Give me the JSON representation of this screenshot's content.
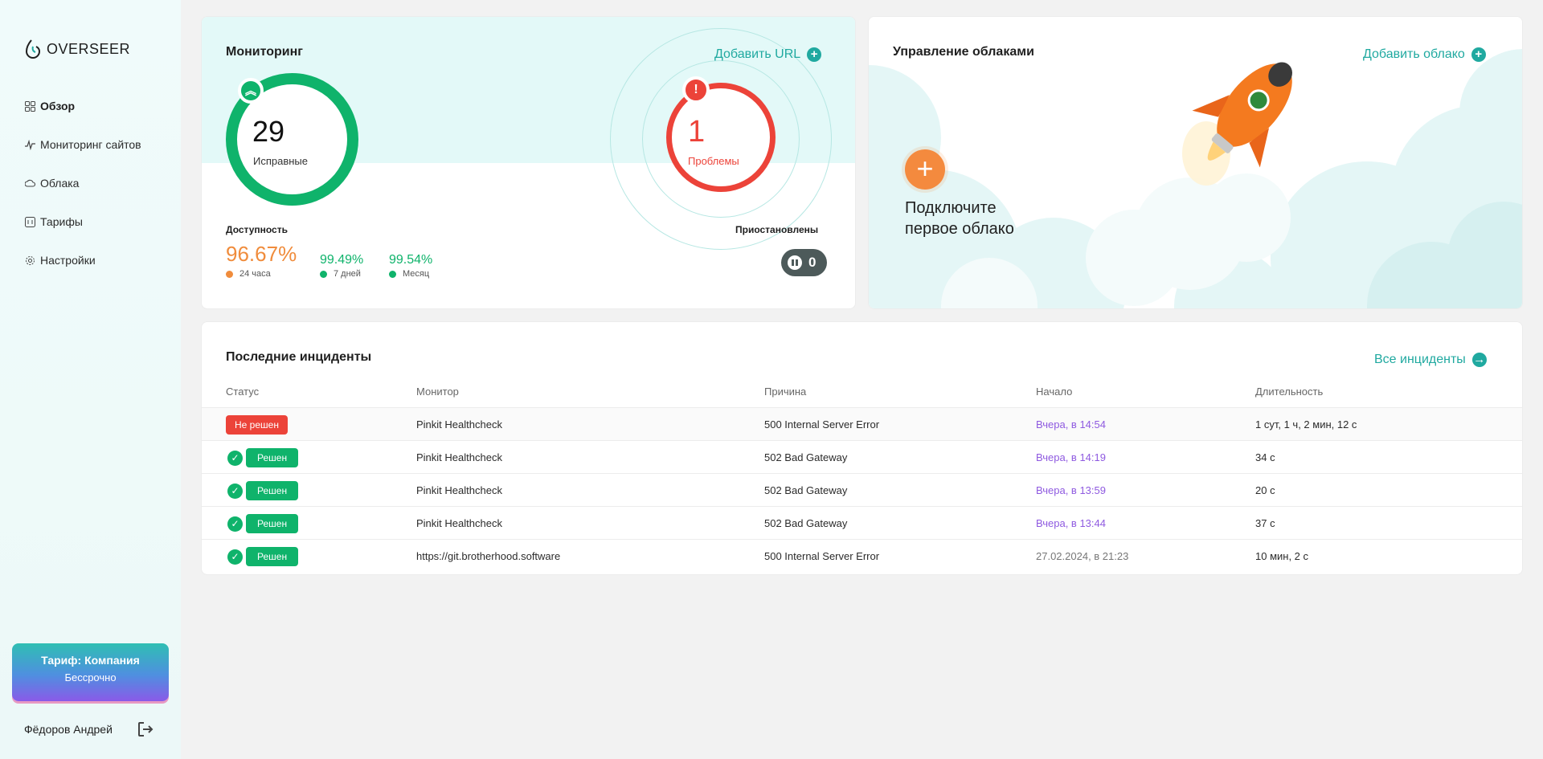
{
  "app": {
    "logo_text": "OVERSEER"
  },
  "sidebar": {
    "items": [
      {
        "label": "Обзор",
        "icon": "grid-icon"
      },
      {
        "label": "Мониторинг сайтов",
        "icon": "pulse-icon"
      },
      {
        "label": "Облака",
        "icon": "cloud-icon"
      },
      {
        "label": "Тарифы",
        "icon": "tariff-icon"
      },
      {
        "label": "Настройки",
        "icon": "gear-icon"
      }
    ],
    "plan": {
      "title": "Тариф: Компания",
      "subtitle": "Бессрочно"
    },
    "user": {
      "name": "Фёдоров Андрей"
    }
  },
  "monitoring": {
    "title": "Мониторинг",
    "add_url_label": "Добавить URL",
    "healthy": {
      "count": "29",
      "label": "Исправные"
    },
    "problems": {
      "count": "1",
      "label": "Проблемы"
    },
    "availability": {
      "title": "Доступность",
      "day": {
        "value": "96.67%",
        "label": "24 часа"
      },
      "week": {
        "value": "99.49%",
        "label": "7 дней"
      },
      "month": {
        "value": "99.54%",
        "label": "Месяц"
      }
    },
    "paused": {
      "title": "Приостановлены",
      "count": "0"
    }
  },
  "clouds": {
    "title": "Управление облаками",
    "add_label": "Добавить облако",
    "cta": "Подключите первое облако"
  },
  "incidents": {
    "title": "Последние инциденты",
    "all_label": "Все инциденты",
    "columns": [
      "Статус",
      "Монитор",
      "Причина",
      "Начало",
      "Длительность"
    ],
    "rows": [
      {
        "status": "Не решен",
        "monitor": "Pinkit Healthcheck",
        "reason": "500 Internal Server Error",
        "start": "Вчера, в 14:54",
        "duration": "1 сут, 1 ч, 2 мин, 12 с"
      },
      {
        "status": "Решен",
        "monitor": "Pinkit Healthcheck",
        "reason": "502 Bad Gateway",
        "start": "Вчера, в 14:19",
        "duration": "34 с"
      },
      {
        "status": "Решен",
        "monitor": "Pinkit Healthcheck",
        "reason": "502 Bad Gateway",
        "start": "Вчера, в 13:59",
        "duration": "20 с"
      },
      {
        "status": "Решен",
        "monitor": "Pinkit Healthcheck",
        "reason": "502 Bad Gateway",
        "start": "Вчера, в 13:44",
        "duration": "37 с"
      },
      {
        "status": "Решен",
        "monitor": "https://git.brotherhood.software",
        "reason": "500 Internal Server Error",
        "start": "27.02.2024, в 21:23",
        "duration": "10 мин, 2 с"
      }
    ]
  },
  "colors": {
    "accent": "#20a9a0",
    "ok": "#0fb36b",
    "error": "#ec4339",
    "warn": "#f08c3c",
    "date": "#8f5ae0"
  }
}
